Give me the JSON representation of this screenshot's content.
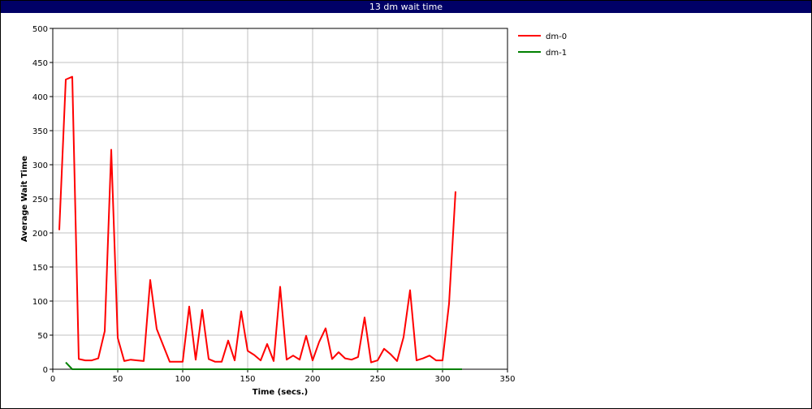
{
  "window": {
    "title": "13 dm wait time"
  },
  "chart_data": {
    "type": "line",
    "title": "13 dm wait time",
    "xlabel": "Time (secs.)",
    "ylabel": "Average Wait Time",
    "xlim": [
      0,
      350
    ],
    "ylim": [
      0,
      500
    ],
    "xticks": [
      0,
      50,
      100,
      150,
      200,
      250,
      300,
      350
    ],
    "yticks": [
      0,
      50,
      100,
      150,
      200,
      250,
      300,
      350,
      400,
      450,
      500
    ],
    "grid": true,
    "legend_position": "right",
    "series": [
      {
        "name": "dm-0",
        "color": "#ff0000",
        "points": [
          [
            5,
            204
          ],
          [
            10,
            425
          ],
          [
            15,
            429
          ],
          [
            20,
            15
          ],
          [
            25,
            13
          ],
          [
            30,
            13
          ],
          [
            35,
            16
          ],
          [
            40,
            56
          ],
          [
            45,
            322
          ],
          [
            50,
            46
          ],
          [
            55,
            12
          ],
          [
            60,
            14
          ],
          [
            65,
            13
          ],
          [
            70,
            12
          ],
          [
            75,
            131
          ],
          [
            80,
            59
          ],
          [
            85,
            35
          ],
          [
            90,
            11
          ],
          [
            95,
            11
          ],
          [
            100,
            11
          ],
          [
            105,
            92
          ],
          [
            110,
            14
          ],
          [
            115,
            87
          ],
          [
            120,
            15
          ],
          [
            125,
            11
          ],
          [
            130,
            11
          ],
          [
            135,
            42
          ],
          [
            140,
            13
          ],
          [
            145,
            85
          ],
          [
            150,
            27
          ],
          [
            155,
            21
          ],
          [
            160,
            13
          ],
          [
            165,
            37
          ],
          [
            170,
            12
          ],
          [
            175,
            121
          ],
          [
            180,
            14
          ],
          [
            185,
            20
          ],
          [
            190,
            14
          ],
          [
            195,
            49
          ],
          [
            200,
            13
          ],
          [
            205,
            40
          ],
          [
            210,
            60
          ],
          [
            215,
            15
          ],
          [
            220,
            25
          ],
          [
            225,
            16
          ],
          [
            230,
            14
          ],
          [
            235,
            18
          ],
          [
            240,
            76
          ],
          [
            245,
            10
          ],
          [
            250,
            13
          ],
          [
            255,
            30
          ],
          [
            260,
            22
          ],
          [
            265,
            12
          ],
          [
            270,
            47
          ],
          [
            275,
            116
          ],
          [
            280,
            13
          ],
          [
            285,
            16
          ],
          [
            290,
            20
          ],
          [
            295,
            13
          ],
          [
            300,
            13
          ],
          [
            305,
            96
          ],
          [
            310,
            261
          ]
        ]
      },
      {
        "name": "dm-1",
        "color": "#008000",
        "points": [
          [
            10,
            10
          ],
          [
            15,
            0
          ],
          [
            20,
            0
          ],
          [
            50,
            0
          ],
          [
            100,
            0
          ],
          [
            150,
            0
          ],
          [
            200,
            0
          ],
          [
            250,
            0
          ],
          [
            300,
            0
          ],
          [
            315,
            0
          ]
        ]
      }
    ]
  }
}
